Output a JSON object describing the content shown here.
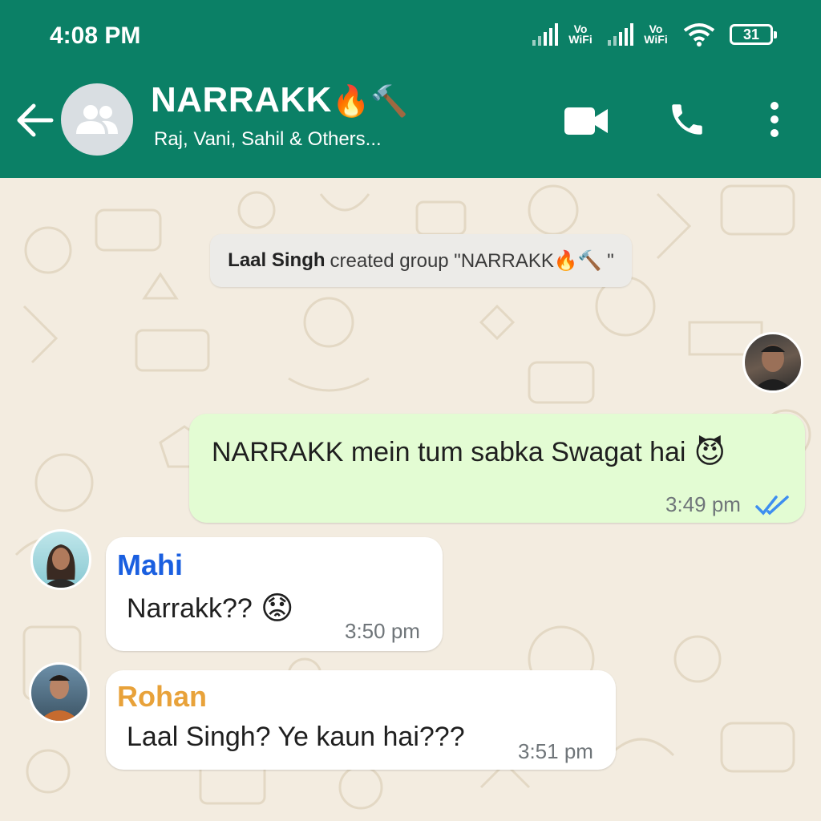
{
  "status_bar": {
    "time": "4:08 PM",
    "vowifi_1": "Vo WiFi",
    "vowifi_2": "Vo WiFi",
    "battery": "31"
  },
  "header": {
    "title": "NARRAKK",
    "title_emoji": "🔥🔨",
    "members": "Raj, Vani, Sahil & Others..."
  },
  "system_message": {
    "name": "Laal Singh",
    "text": "created group \"NARRAKK🔥🔨 \""
  },
  "messages": [
    {
      "direction": "outgoing",
      "text": "NARRAKK mein tum sabka Swagat hai",
      "emoji": "😈",
      "time": "3:49 pm",
      "ticks": "read"
    },
    {
      "direction": "incoming",
      "sender": "Mahi",
      "sender_color": "#1a5fe0",
      "text": "Narrakk??",
      "emoji": "😟",
      "time": "3:50 pm"
    },
    {
      "direction": "incoming",
      "sender": "Rohan",
      "sender_color": "#e8a23a",
      "text": "Laal Singh? Ye kaun hai???",
      "time": "3:51 pm"
    }
  ],
  "icons": {
    "back": "arrow-left-icon",
    "video": "video-call-icon",
    "call": "phone-icon",
    "menu": "more-vert-icon"
  },
  "colors": {
    "header": "#0b8066",
    "outgoing_bubble": "#e3fcd3",
    "incoming_bubble": "#ffffff",
    "tick": "#3e8ef0"
  }
}
